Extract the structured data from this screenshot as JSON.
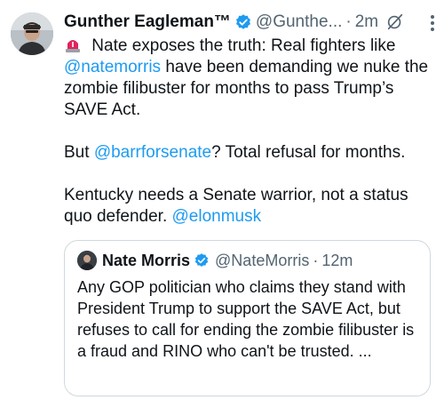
{
  "tweet": {
    "author_name": "Gunther Eagleman™",
    "handle": "@Gunthe...",
    "separator": "·",
    "time": "2m",
    "verified_icon": "verified-badge-icon",
    "grok_icon": "grok-icon",
    "emoji_icon": "police-siren-icon",
    "lines": {
      "p1_a": " Nate exposes the truth: Real fighters like ",
      "p1_mention": "@natemorris",
      "p1_b": " have been demanding we nuke the zombie filibuster for months to pass Trump’s SAVE Act.",
      "p2_a": "But ",
      "p2_mention": "@barrforsenate",
      "p2_b": "? Total refusal for months.",
      "p3_a": "Kentucky needs a Senate warrior, not a status quo defender. ",
      "p3_mention": "@elonmusk"
    }
  },
  "quote": {
    "author_name": "Nate Morris",
    "handle": "@NateMorris",
    "separator": "·",
    "time": "12m",
    "text": "Any GOP politician who claims they stand with President Trump to support the SAVE Act, but refuses to call for ending the zombie filibuster is a fraud and RINO who can't be trusted. ..."
  },
  "colors": {
    "text": "#0f1419",
    "muted": "#536471",
    "link": "#1d9bf0",
    "border": "#cfd9de",
    "verified": "#1d9bf0"
  }
}
